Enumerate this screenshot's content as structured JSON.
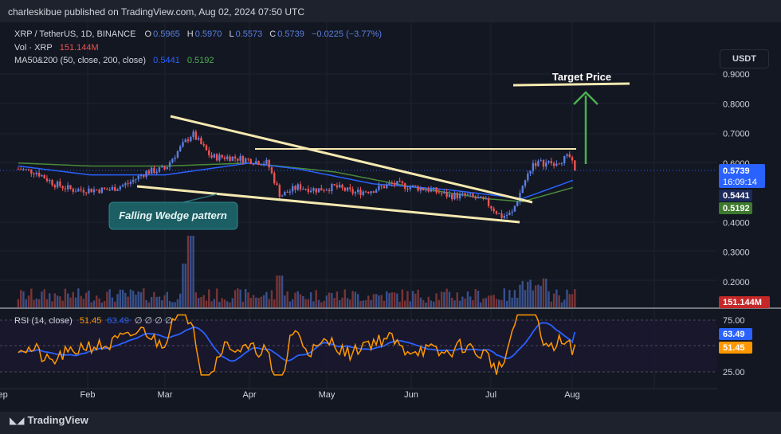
{
  "header": {
    "publisher": "charleskibue published on TradingView.com, Aug 02, 2024 07:50 UTC"
  },
  "legend": {
    "symbol": "XRP / TetherUS, 1D, BINANCE",
    "open_label": "O",
    "open": "0.5965",
    "high_label": "H",
    "high": "0.5970",
    "low_label": "L",
    "low": "0.5573",
    "close_label": "C",
    "close": "0.5739",
    "change": "−0.0225 (−3.77%)",
    "vol_label": "Vol · XRP",
    "vol_value": "151.144M",
    "ma_label": "MA50&200 (50, close, 200, close)",
    "ma50_value": "0.5441",
    "ma200_value": "0.5192",
    "rsi_label": "RSI (14, close)",
    "rsi_value": "51.45",
    "rsi_ma_value": "63.49",
    "rsi_extra": "∅ ∅ ∅ ∅"
  },
  "currency_button": "USDT",
  "annotations": {
    "pattern_label": "Falling Wedge pattern",
    "target_label": "Target Price"
  },
  "price_tags": {
    "last": "0.5739",
    "countdown": "16:09:14",
    "ma50": "0.5441",
    "ma200": "0.5192",
    "volume": "151.144M",
    "rsi_ma": "63.49",
    "rsi": "51.45"
  },
  "footer": {
    "brand": "TradingView"
  },
  "colors": {
    "up": "#5b7fe0",
    "down": "#ef5350",
    "ma50": "#2962ff",
    "ma200": "#4a8a3a",
    "rsi": "#ff9800",
    "rsi_ma": "#2962ff",
    "wedge": "#f5e9b0",
    "target_arrow": "#4caf50"
  },
  "chart_data": {
    "type": "line",
    "title": "XRP / TetherUS, 1D, BINANCE",
    "x": [
      "Feb",
      "Mar",
      "Apr",
      "May",
      "Jun",
      "Jul",
      "Aug",
      "Sep"
    ],
    "y_ticks": [
      "0.9000",
      "0.8000",
      "0.7000",
      "0.6000",
      "0.4000",
      "0.3000",
      "0.2000"
    ],
    "rsi_ticks": [
      "75.00",
      "25.00"
    ],
    "ylim": [
      0.15,
      0.95
    ],
    "series": [
      {
        "name": "XRP / TetherUS",
        "points": [
          [
            "Jan 5",
            0.58
          ],
          [
            "Jan 12",
            0.57
          ],
          [
            "Jan 19",
            0.53
          ],
          [
            "Jan 26",
            0.51
          ],
          [
            "Feb 2",
            0.51
          ],
          [
            "Feb 9",
            0.51
          ],
          [
            "Feb 16",
            0.53
          ],
          [
            "Feb 23",
            0.57
          ],
          [
            "Mar 1",
            0.58
          ],
          [
            "Mar 4",
            0.62
          ],
          [
            "Mar 11",
            0.7
          ],
          [
            "Mar 18",
            0.62
          ],
          [
            "Mar 25",
            0.62
          ],
          [
            "Apr 1",
            0.61
          ],
          [
            "Apr 8",
            0.6
          ],
          [
            "Apr 13",
            0.49
          ],
          [
            "Apr 20",
            0.52
          ],
          [
            "Apr 27",
            0.51
          ],
          [
            "May 4",
            0.52
          ],
          [
            "May 11",
            0.5
          ],
          [
            "May 18",
            0.51
          ],
          [
            "May 25",
            0.53
          ],
          [
            "Jun 1",
            0.52
          ],
          [
            "Jun 8",
            0.51
          ],
          [
            "Jun 15",
            0.49
          ],
          [
            "Jun 22",
            0.49
          ],
          [
            "Jun 29",
            0.47
          ],
          [
            "Jul 5",
            0.42
          ],
          [
            "Jul 9",
            0.43
          ],
          [
            "Jul 13",
            0.52
          ],
          [
            "Jul 17",
            0.6
          ],
          [
            "Jul 24",
            0.6
          ],
          [
            "Jul 31",
            0.62
          ],
          [
            "Aug 2",
            0.5739
          ]
        ]
      },
      {
        "name": "MA50",
        "points": [
          [
            "Jan 5",
            0.59
          ],
          [
            "Feb 2",
            0.56
          ],
          [
            "Mar 1",
            0.56
          ],
          [
            "Apr 1",
            0.6
          ],
          [
            "Apr 20",
            0.58
          ],
          [
            "May 18",
            0.53
          ],
          [
            "Jun 15",
            0.51
          ],
          [
            "Jul 13",
            0.48
          ],
          [
            "Aug 2",
            0.5441
          ]
        ]
      },
      {
        "name": "MA200",
        "points": [
          [
            "Jan 5",
            0.6
          ],
          [
            "Feb 2",
            0.59
          ],
          [
            "Mar 1",
            0.59
          ],
          [
            "Apr 1",
            0.6
          ],
          [
            "May 4",
            0.57
          ],
          [
            "Jun 1",
            0.52
          ],
          [
            "Jun 29",
            0.48
          ],
          [
            "Jul 13",
            0.47
          ],
          [
            "Aug 2",
            0.5192
          ]
        ]
      }
    ],
    "annotations": [
      "Falling Wedge pattern",
      "Target Price"
    ],
    "grid": true,
    "legend_position": "top-left"
  }
}
